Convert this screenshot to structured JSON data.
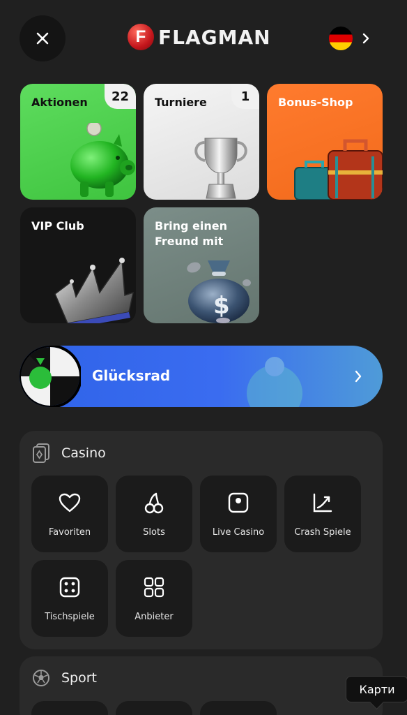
{
  "header": {
    "logo_letter": "F",
    "logo_text": "FLAGMAN",
    "language_flag": "germany-flag-icon",
    "close_icon": "close-icon",
    "chevron_icon": "chevron-right-icon"
  },
  "promos": [
    {
      "label": "Aktionen",
      "badge": "22",
      "icon": "piggy-bank-icon",
      "color": "#4fd14f"
    },
    {
      "label": "Turniere",
      "badge": "1",
      "icon": "trophy-icon",
      "color": "#ececec"
    },
    {
      "label": "Bonus-Shop",
      "icon": "suitcase-icon",
      "color": "#f5731f"
    },
    {
      "label": "VIP Club",
      "icon": "crown-icon",
      "color": "#151515"
    },
    {
      "label": "Bring einen Freund mit",
      "icon": "money-bag-icon",
      "color": "#72837e"
    }
  ],
  "wheel": {
    "label": "Glücksrad",
    "icon": "fortune-wheel-icon",
    "color": "#3366ee"
  },
  "casino": {
    "title": "Casino",
    "icon": "cards-icon",
    "items": [
      {
        "label": "Favoriten",
        "icon": "heart-icon"
      },
      {
        "label": "Slots",
        "icon": "cherries-icon"
      },
      {
        "label": "Live Casino",
        "icon": "live-icon"
      },
      {
        "label": "Crash Spiele",
        "icon": "chart-up-icon"
      },
      {
        "label": "Tischspiele",
        "icon": "dice-icon"
      },
      {
        "label": "Anbieter",
        "icon": "grid-icon"
      }
    ]
  },
  "sport": {
    "title": "Sport",
    "icon": "soccer-ball-icon"
  },
  "tooltip": {
    "text": "Карти"
  }
}
